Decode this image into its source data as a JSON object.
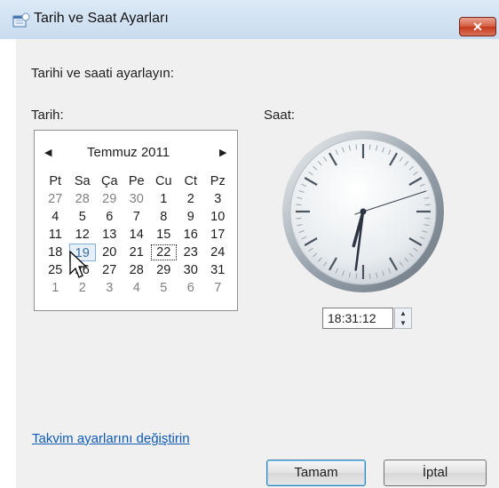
{
  "window": {
    "title": "Tarih ve Saat Ayarları",
    "close_label": "✕"
  },
  "prompt": "Tarihi ve saati ayarlayın:",
  "date_label": "Tarih:",
  "time_label": "Saat:",
  "calendar": {
    "month_label": "Temmuz 2011",
    "prev_glyph": "◀",
    "next_glyph": "▶",
    "weekdays": [
      "Pt",
      "Sa",
      "Ça",
      "Pe",
      "Cu",
      "Ct",
      "Pz"
    ],
    "weeks": [
      [
        {
          "d": "27",
          "m": true
        },
        {
          "d": "28",
          "m": true
        },
        {
          "d": "29",
          "m": true
        },
        {
          "d": "30",
          "m": true
        },
        {
          "d": "1"
        },
        {
          "d": "2"
        },
        {
          "d": "3"
        }
      ],
      [
        {
          "d": "4"
        },
        {
          "d": "5"
        },
        {
          "d": "6"
        },
        {
          "d": "7"
        },
        {
          "d": "8"
        },
        {
          "d": "9"
        },
        {
          "d": "10"
        }
      ],
      [
        {
          "d": "11"
        },
        {
          "d": "12"
        },
        {
          "d": "13"
        },
        {
          "d": "14"
        },
        {
          "d": "15"
        },
        {
          "d": "16"
        },
        {
          "d": "17"
        }
      ],
      [
        {
          "d": "18"
        },
        {
          "d": "19",
          "sel": true
        },
        {
          "d": "20"
        },
        {
          "d": "21"
        },
        {
          "d": "22",
          "today": true
        },
        {
          "d": "23"
        },
        {
          "d": "24"
        }
      ],
      [
        {
          "d": "25"
        },
        {
          "d": "26"
        },
        {
          "d": "27"
        },
        {
          "d": "28"
        },
        {
          "d": "29"
        },
        {
          "d": "30"
        },
        {
          "d": "31"
        }
      ],
      [
        {
          "d": "1",
          "m": true
        },
        {
          "d": "2",
          "m": true
        },
        {
          "d": "3",
          "m": true
        },
        {
          "d": "4",
          "m": true
        },
        {
          "d": "5",
          "m": true
        },
        {
          "d": "6",
          "m": true
        },
        {
          "d": "7",
          "m": true
        }
      ]
    ]
  },
  "clock": {
    "hour": 18,
    "minute": 31,
    "second": 12
  },
  "time_value": "18:31:12",
  "link": "Takvim ayarlarını değiştirin",
  "buttons": {
    "ok": "Tamam",
    "cancel": "İptal"
  },
  "colors": {
    "link": "#0f5ab4",
    "titlebar": "#dce9f6",
    "close": "#c7391c"
  }
}
